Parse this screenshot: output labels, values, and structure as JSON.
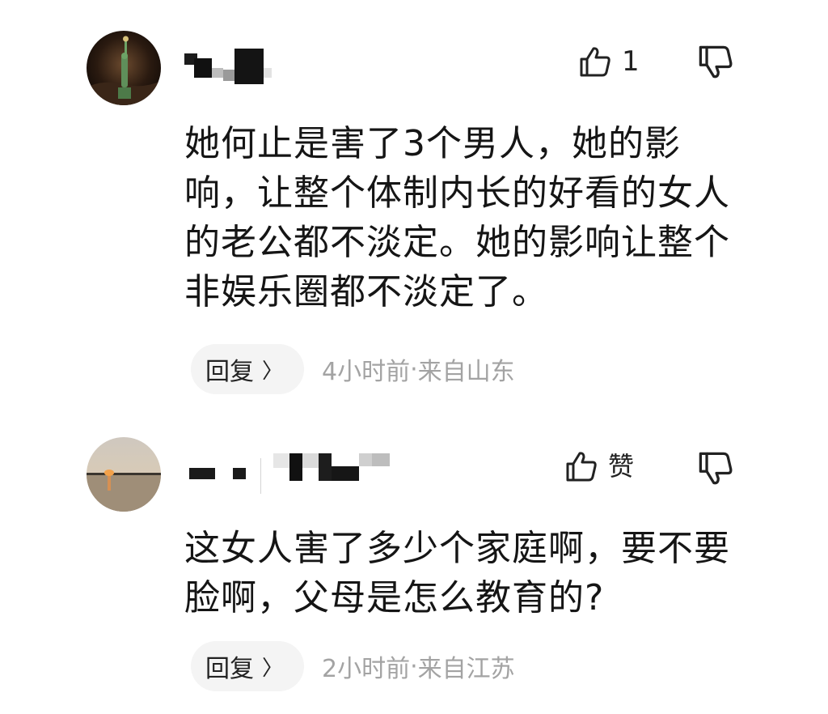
{
  "comments": [
    {
      "avatar_icon": "statue-of-liberty-avatar",
      "likes": "1",
      "text": "她何止是害了3个男人，她的影响，让整个体制内长的好看的女人的老公都不淡定。她的影响让整个非娱乐圈都不淡定了。",
      "reply_label": "回复",
      "time": "4小时前",
      "separator": " · ",
      "location": "来自山东"
    },
    {
      "avatar_icon": "sunset-lake-avatar",
      "likes": "赞",
      "text": "这女人害了多少个家庭啊，要不要脸啊，父母是怎么教育的?",
      "reply_label": "回复",
      "time": "2小时前",
      "separator": " · ",
      "location": "来自江苏"
    }
  ],
  "icons": {
    "like": "thumbs-up-icon",
    "dislike": "thumbs-down-icon",
    "chevron": "chevron-right-icon"
  },
  "colors": {
    "text": "#151515",
    "meta": "#a3a3a3",
    "reply_bg": "#f4f4f4"
  }
}
